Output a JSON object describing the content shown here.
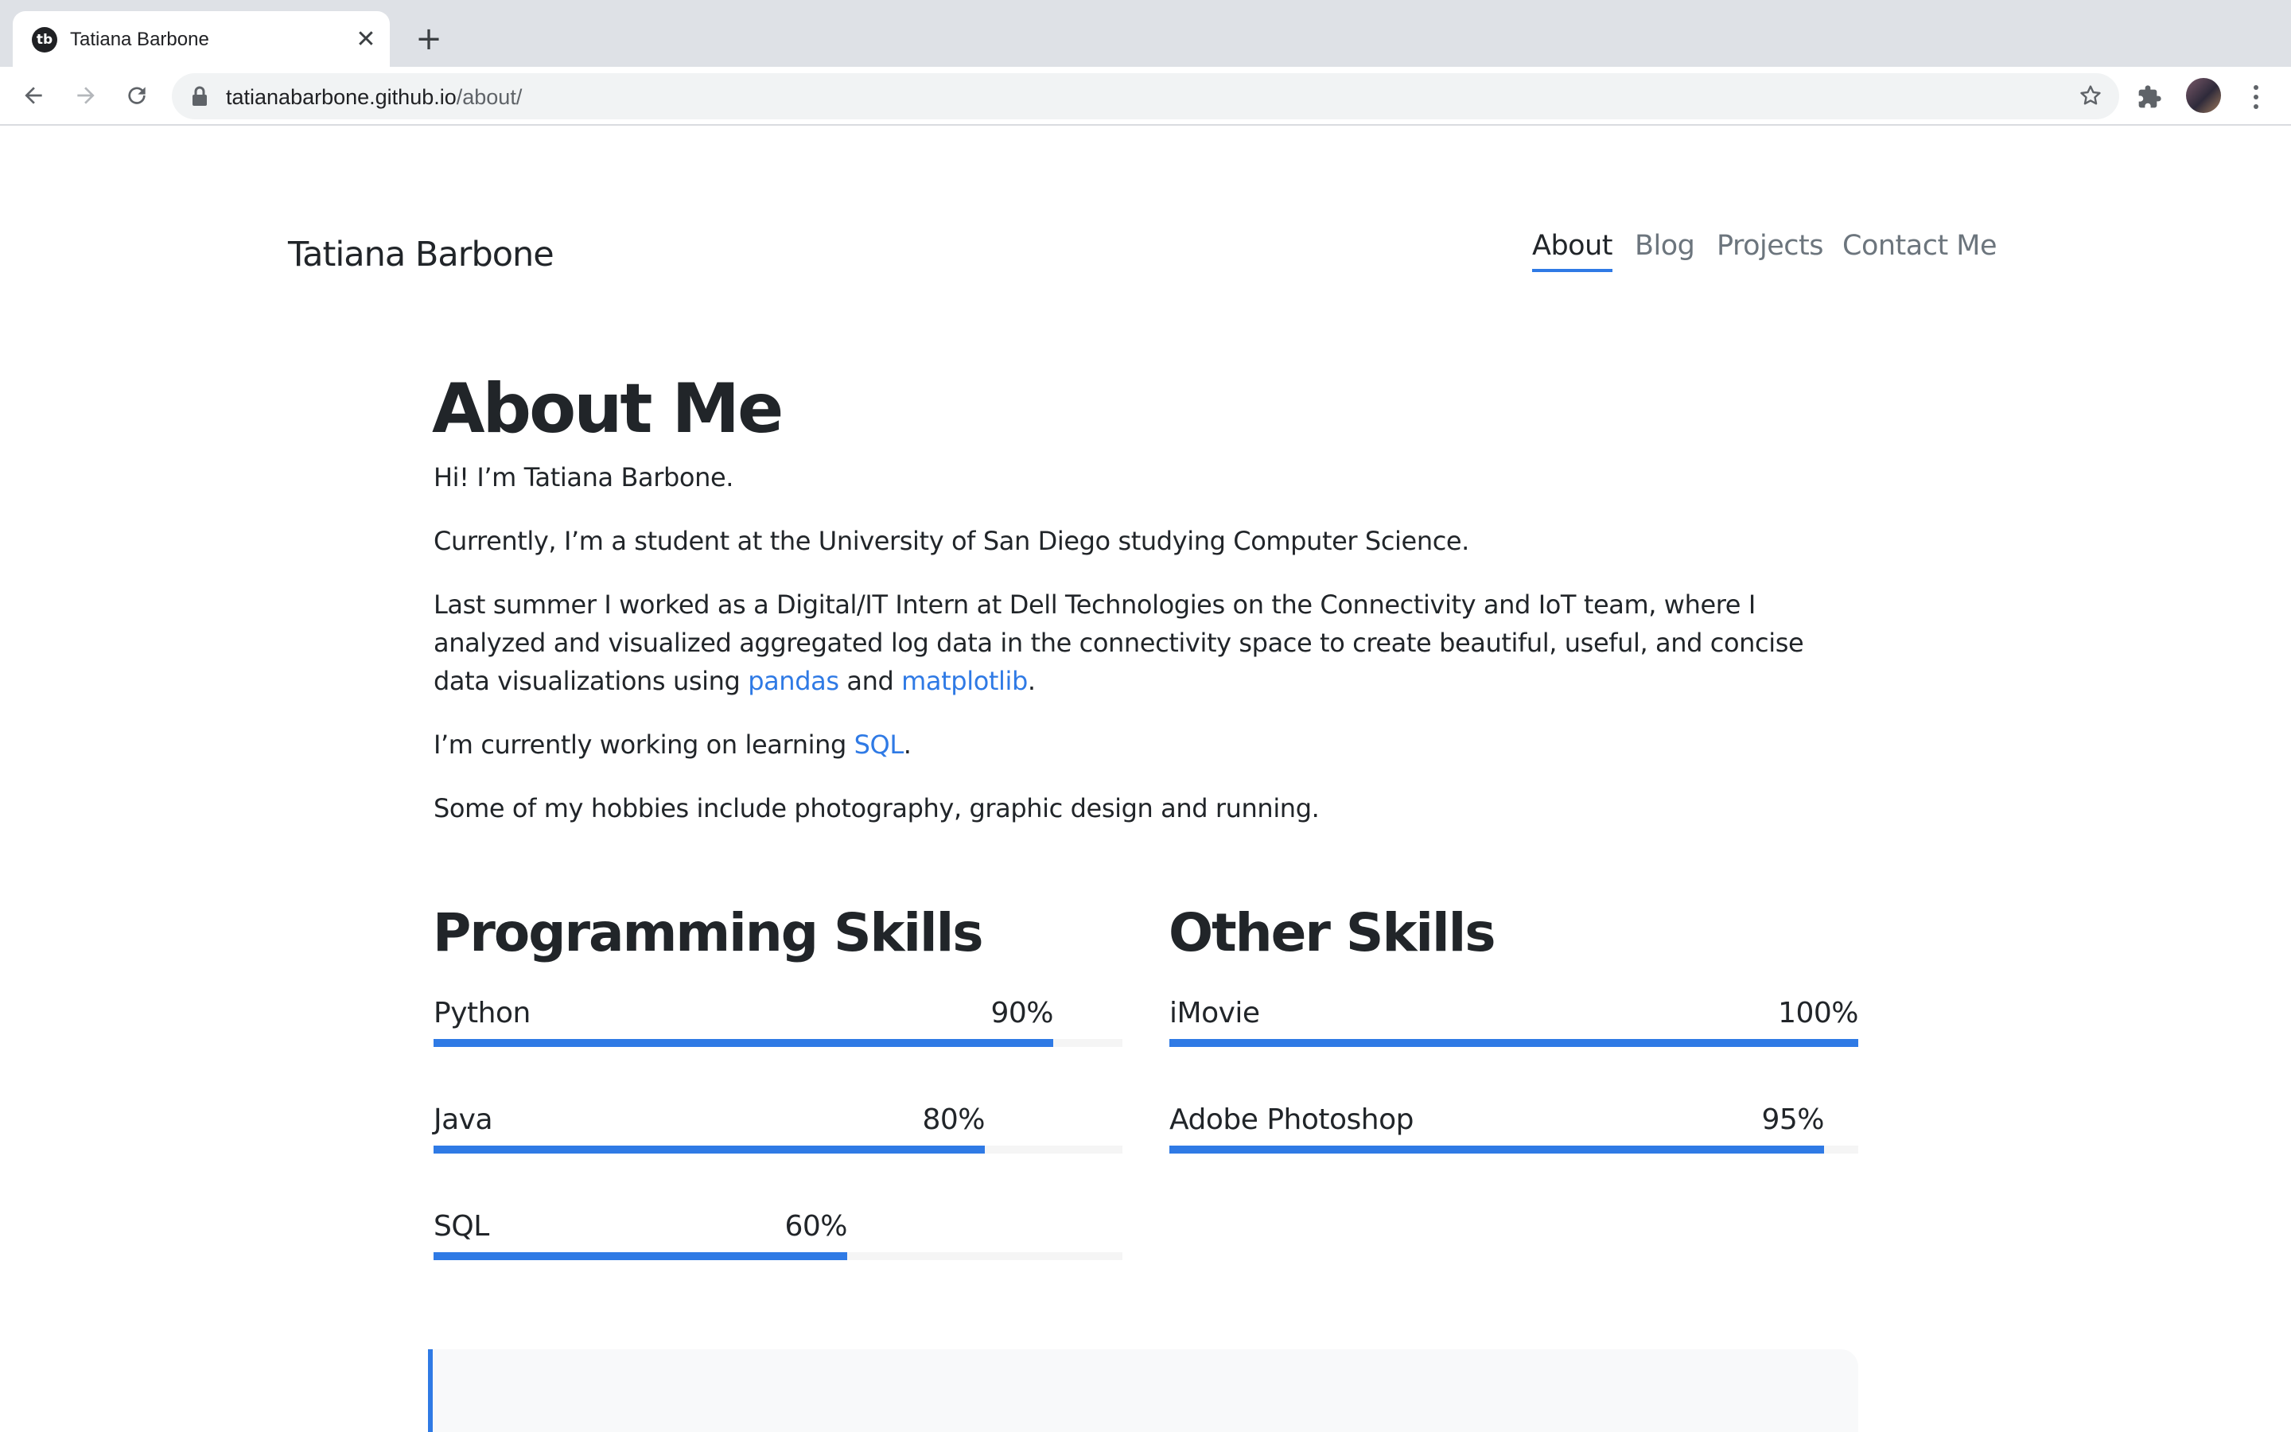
{
  "browser": {
    "tab_title": "Tatiana Barbone",
    "favicon_text": "tb",
    "close_glyph": "✕",
    "newtab_glyph": "+",
    "url_host": "tatianabarbone.github.io",
    "url_path": "/about/",
    "icons": [
      "back-arrow-icon",
      "forward-arrow-icon",
      "reload-icon",
      "lock-icon",
      "bookmark-star-icon",
      "extensions-puzzle-icon",
      "profile-avatar",
      "kebab-menu-icon"
    ]
  },
  "site": {
    "title": "Tatiana Barbone",
    "nav": [
      {
        "label": "About",
        "active": true
      },
      {
        "label": "Blog",
        "active": false
      },
      {
        "label": "Projects",
        "active": false
      },
      {
        "label": "Contact Me",
        "active": false
      }
    ]
  },
  "about": {
    "heading": "About Me",
    "intro": "Hi! I’m Tatiana Barbone.",
    "current": "Currently, I’m a student at the University of San Diego studying Computer Science.",
    "summer_prefix": "Last summer I worked as a Digital/IT Intern at Dell Technologies on the Connectivity and IoT team, where I analyzed and visualized aggregated log data in the connectivity space to create beautiful, useful, and concise data visualizations using ",
    "summer_link1": "pandas",
    "summer_mid": " and ",
    "summer_link2": "matplotlib",
    "summer_suffix": ".",
    "learning_prefix": "I’m currently working on learning ",
    "learning_link": "SQL",
    "learning_suffix": ".",
    "hobbies": "Some of my hobbies include photography, graphic design and running."
  },
  "programming_skills": {
    "heading": "Programming Skills",
    "items": [
      {
        "name": "Python",
        "percent_label": "90%",
        "percent": 90
      },
      {
        "name": "Java",
        "percent_label": "80%",
        "percent": 80
      },
      {
        "name": "SQL",
        "percent_label": "60%",
        "percent": 60
      }
    ]
  },
  "other_skills": {
    "heading": "Other Skills",
    "items": [
      {
        "name": "iMovie",
        "percent_label": "100%",
        "percent": 100
      },
      {
        "name": "Adobe Photoshop",
        "percent_label": "95%",
        "percent": 95
      }
    ]
  },
  "colors": {
    "accent": "#2f7ae5",
    "text": "#212529",
    "muted": "#6c757d",
    "chrome_bg": "#dee1e6"
  }
}
